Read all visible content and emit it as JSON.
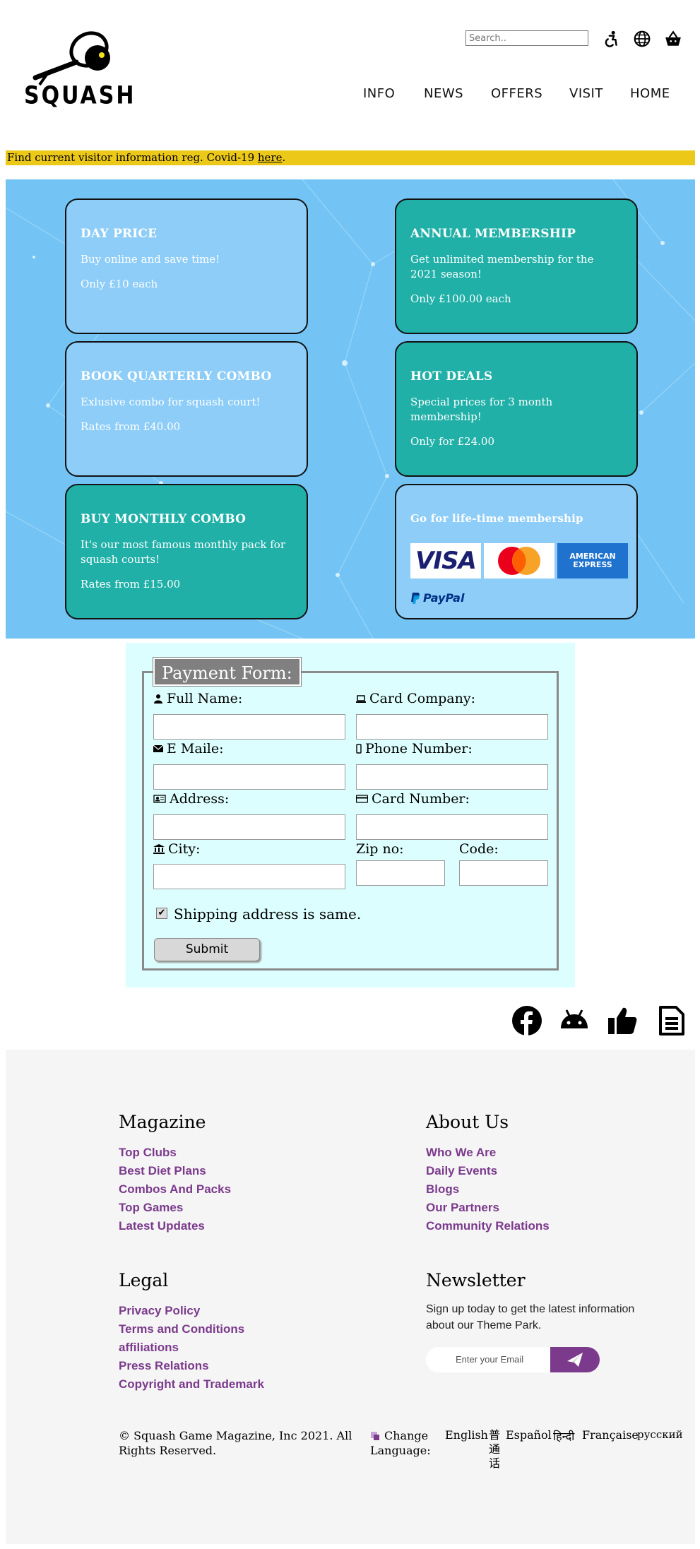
{
  "header": {
    "logo_text": "SQUASH",
    "search_placeholder": "Search..",
    "icons": [
      "accessibility-icon",
      "globe-icon",
      "basket-icon"
    ],
    "nav": [
      "INFO",
      "NEWS",
      "OFFERS",
      "VISIT",
      "HOME"
    ]
  },
  "notice": {
    "text": "Find current visitor information reg. Covid-19 ",
    "link": "here",
    "tail": ".",
    "color": "#ecc819"
  },
  "offers": [
    {
      "title": "DAY PRICE",
      "desc": "Buy online and save time!",
      "price": "Only £10 each",
      "color": "#8dcdf7"
    },
    {
      "title": "ANNUAL MEMBERSHIP",
      "desc": "Get unlimited membership for the 2021 season!",
      "price": "Only £100.00 each",
      "color": "#20b0a7"
    },
    {
      "title": "BOOK QUARTERLY COMBO",
      "desc": "Exlusive combo for squash court!",
      "price": "Rates from £40.00",
      "color": "#8dcdf7"
    },
    {
      "title": "HOT DEALS",
      "desc": "Special prices for 3 month membership!",
      "price": "Only for £24.00",
      "color": "#20b0a7"
    },
    {
      "title": "BUY MONTHLY COMBO",
      "desc": "It's our most famous monthly pack for squash courts!",
      "price": "Rates from £15.00",
      "color": "#20b0a7"
    }
  ],
  "lifetime": {
    "title": "Go for life-time membership",
    "logos": [
      "VISA",
      "mastercard",
      "AMERICAN EXPRESS",
      "PayPal"
    ]
  },
  "form": {
    "legend": "Payment Form:",
    "full_name": "Full Name:",
    "card_company": "Card Company:",
    "email": "E Maile:",
    "phone": "Phone Number:",
    "address": "Address:",
    "card_number": "Card Number:",
    "city": "City:",
    "zip": "Zip no:",
    "code": "Code:",
    "shipping": "Shipping address is same.",
    "shipping_checked": true,
    "submit": "Submit"
  },
  "social": [
    "facebook-icon",
    "android-icon",
    "thumbs-up-icon",
    "document-icon"
  ],
  "footer": {
    "magazine": {
      "heading": "Magazine",
      "links": [
        "Top Clubs",
        "Best Diet Plans",
        "Combos And Packs",
        "Top Games",
        "Latest Updates"
      ]
    },
    "about": {
      "heading": "About Us",
      "links": [
        "Who We Are",
        "Daily Events",
        "Blogs",
        "Our Partners",
        "Community Relations"
      ]
    },
    "legal": {
      "heading": "Legal",
      "links": [
        "Privacy Policy",
        "Terms and Conditions",
        "affiliations",
        "Press Relations",
        "Copyright and Trademark"
      ]
    },
    "newsletter": {
      "heading": "Newsletter",
      "text": "Sign up today to get the latest information about our Theme Park.",
      "placeholder": "Enter your Email"
    },
    "copyright": "© Squash Game Magazine, Inc 2021. All Rights Reserved.",
    "change_language": "Change Language:",
    "languages": [
      "English",
      "普通话",
      "Español",
      "हिन्दी",
      "Française",
      "русский"
    ],
    "link_color": "#7b3a8c"
  }
}
